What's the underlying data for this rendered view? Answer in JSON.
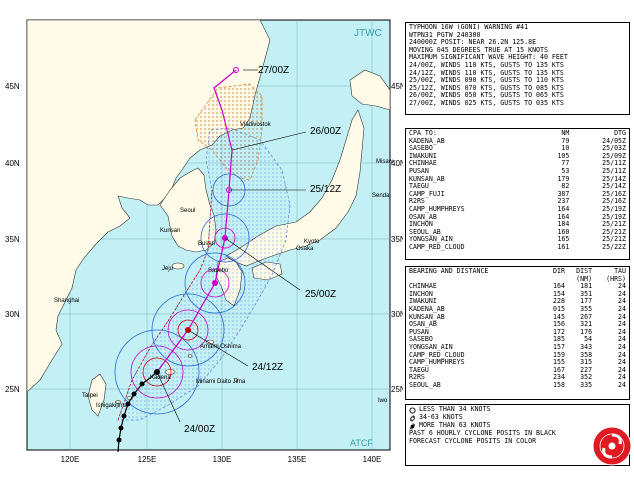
{
  "map": {
    "agency_label": "JTWC",
    "agency_label_bottom": "ATCF",
    "lat_labels": [
      "45N",
      "40N",
      "35N",
      "30N",
      "25N"
    ],
    "lat_labels_right": [
      "45N",
      "40N",
      "35N",
      "30N",
      "25N"
    ],
    "lon_labels": [
      "120E",
      "125E",
      "130E",
      "135E",
      "140E"
    ],
    "forecast_labels": [
      "27/00Z",
      "26/00Z",
      "25/12Z",
      "25/00Z",
      "24/12Z",
      "24/00Z"
    ],
    "places": [
      "Vladivostok",
      "Misaw",
      "Sendai",
      "Seoul",
      "Kunsan",
      "Busan",
      "Sasebo",
      "Jeju",
      "Osaka",
      "Kyoto",
      "Shanghai",
      "Amami Oshima",
      "Kadena",
      "Minami Daito Jima",
      "Taipei",
      "Ishigakijima",
      "Iwo"
    ],
    "colors": {
      "sea": "#bff0f5",
      "land": "#fffbe8",
      "track": "#cc00cc",
      "wind34": "#2b6cd8",
      "wind50": "#cc00cc",
      "wind64": "#d40000",
      "swath_34": "#6a8fd6",
      "swath_warn": "#d98a3a",
      "past_track": "#000000"
    }
  },
  "header": {
    "lines": [
      "TYPHOON 16W (GONI) WARNING #41",
      "WTPN31 PGTW 240300",
      "240000Z POSIT: NEAR 26.2N 125.8E",
      "MOVING 045 DEGREES TRUE AT 15 KNOTS",
      "MAXIMUM SIGNIFICANT WAVE HEIGHT: 40 FEET",
      "24/00Z, WINDS 110 KTS, GUSTS TO 135 KTS",
      "24/12Z, WINDS 110 KTS, GUSTS TO 135 KTS",
      "25/00Z, WINDS 090 KTS, GUSTS TO 110 KTS",
      "25/12Z, WINDS 070 KTS, GUSTS TO 085 KTS",
      "26/00Z, WINDS 050 KTS, GUSTS TO 065 KTS",
      "27/00Z, WINDS 025 KTS, GUSTS TO 035 KTS"
    ]
  },
  "cpa": {
    "headers": [
      "CPA TO:",
      "NM",
      "DTG"
    ],
    "rows": [
      [
        "KADENA_AB",
        "79",
        "24/05Z"
      ],
      [
        "SASEBO",
        "10",
        "25/03Z"
      ],
      [
        "IWAKUNI",
        "105",
        "25/09Z"
      ],
      [
        "CHINHAE",
        "77",
        "25/11Z"
      ],
      [
        "PUSAN",
        "53",
        "25/11Z"
      ],
      [
        "KUNSAN_AB",
        "179",
        "25/14Z"
      ],
      [
        "TAEGU",
        "82",
        "25/14Z"
      ],
      [
        "CAMP_FUJI",
        "387",
        "25/16Z"
      ],
      [
        "R2RS",
        "237",
        "25/16Z"
      ],
      [
        "CAMP_HUMPHREYS",
        "164",
        "25/19Z"
      ],
      [
        "OSAN_AB",
        "164",
        "25/19Z"
      ],
      [
        "INCHON",
        "184",
        "25/21Z"
      ],
      [
        "SEOUL_AB",
        "160",
        "25/21Z"
      ],
      [
        "YONGSAN_AIN",
        "165",
        "25/21Z"
      ],
      [
        "CAMP_RED_CLOUD",
        "161",
        "25/22Z"
      ]
    ]
  },
  "bearing": {
    "headers": [
      "BEARING AND DISTANCE",
      "DIR",
      "DIST",
      "TAU"
    ],
    "subheaders": [
      "",
      "",
      "(NM)",
      "(HRS)"
    ],
    "rows": [
      [
        "CHINHAE",
        "164",
        "181",
        "24"
      ],
      [
        "INCHON",
        "154",
        "351",
        "24"
      ],
      [
        "IWAKUNI",
        "228",
        "177",
        "24"
      ],
      [
        "KADENA_AB",
        "015",
        "355",
        "24"
      ],
      [
        "KUNSAN_AB",
        "145",
        "267",
        "24"
      ],
      [
        "OSAN_AB",
        "156",
        "321",
        "24"
      ],
      [
        "PUSAN",
        "172",
        "176",
        "24"
      ],
      [
        "SASEBO",
        "185",
        "54",
        "24"
      ],
      [
        "YONGSAN_AIN",
        "157",
        "343",
        "24"
      ],
      [
        "CAMP_RED_CLOUD",
        "159",
        "358",
        "24"
      ],
      [
        "CAMP_HUMPHREYS",
        "155",
        "315",
        "24"
      ],
      [
        "TAEGU",
        "167",
        "227",
        "24"
      ],
      [
        "R2RS",
        "234",
        "352",
        "24"
      ],
      [
        "SEOUL_AB",
        "158",
        "335",
        "24"
      ]
    ]
  },
  "legend": {
    "items": [
      "LESS THAN 34 KNOTS",
      "34-63 KNOTS",
      "MORE THAN 63 KNOTS"
    ],
    "notes": [
      "PAST 6 HOURLY CYCLONE POSITS IN BLACK",
      "FORECAST CYCLONE POSITS IN COLOR"
    ]
  }
}
